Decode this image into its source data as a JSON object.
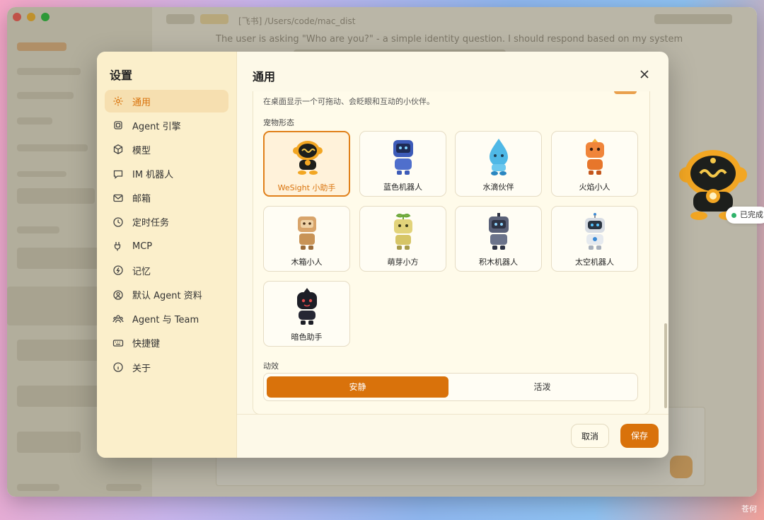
{
  "background_app": {
    "top_text": "The user is asking \"Who are you?\" - a simple identity question. I should respond based on my system",
    "tab": "[飞书] /Users/code/mac_dist"
  },
  "mascot_status": "已完成",
  "dialog": {
    "sidebar_title": "设置",
    "nav": [
      {
        "label": "通用",
        "icon": "gear-icon",
        "active": true
      },
      {
        "label": "Agent 引擎",
        "icon": "chip-icon"
      },
      {
        "label": "模型",
        "icon": "cube-icon"
      },
      {
        "label": "IM 机器人",
        "icon": "chat-bubble-icon"
      },
      {
        "label": "邮箱",
        "icon": "mail-icon"
      },
      {
        "label": "定时任务",
        "icon": "clock-icon"
      },
      {
        "label": "MCP",
        "icon": "plug-icon"
      },
      {
        "label": "记忆",
        "icon": "brain-icon"
      },
      {
        "label": "默认 Agent 资料",
        "icon": "user-circle-icon"
      },
      {
        "label": "Agent 与 Team",
        "icon": "team-icon"
      },
      {
        "label": "快捷键",
        "icon": "keyboard-icon"
      },
      {
        "label": "关于",
        "icon": "info-icon"
      }
    ],
    "title": "通用",
    "pet_description": "在桌面显示一个可拖动、会眨眼和互动的小伙伴。",
    "pet_form_label": "宠物形态",
    "pets": [
      {
        "name": "WeSight 小助手",
        "selected": true,
        "color": "#2a2a2a",
        "accent": "#f2a623"
      },
      {
        "name": "蓝色机器人",
        "color": "#3d5bb8",
        "accent": "#1e2b55"
      },
      {
        "name": "水滴伙伴",
        "color": "#4fb8e6",
        "accent": "#2a86c0"
      },
      {
        "name": "火焰小人",
        "color": "#f0853a",
        "accent": "#c4561c"
      },
      {
        "name": "木箱小人",
        "color": "#d8a46a",
        "accent": "#9a6b3a"
      },
      {
        "name": "萌芽小方",
        "color": "#e2d37a",
        "accent": "#8fb548"
      },
      {
        "name": "积木机器人",
        "color": "#5a6178",
        "accent": "#2e3344"
      },
      {
        "name": "太空机器人",
        "color": "#d8dde4",
        "accent": "#3a8ad6"
      },
      {
        "name": "暗色助手",
        "color": "#1d1e26",
        "accent": "#e24a4a"
      }
    ],
    "motion_label": "动效",
    "motion_options": [
      "安静",
      "活泼"
    ],
    "motion_selected": "安静",
    "cancel_label": "取消",
    "save_label": "保存"
  },
  "watermark": "苍何",
  "colors": {
    "accent": "#d9720b",
    "sidebar_bg": "#fbefcb",
    "panel_bg": "#fffbea"
  }
}
